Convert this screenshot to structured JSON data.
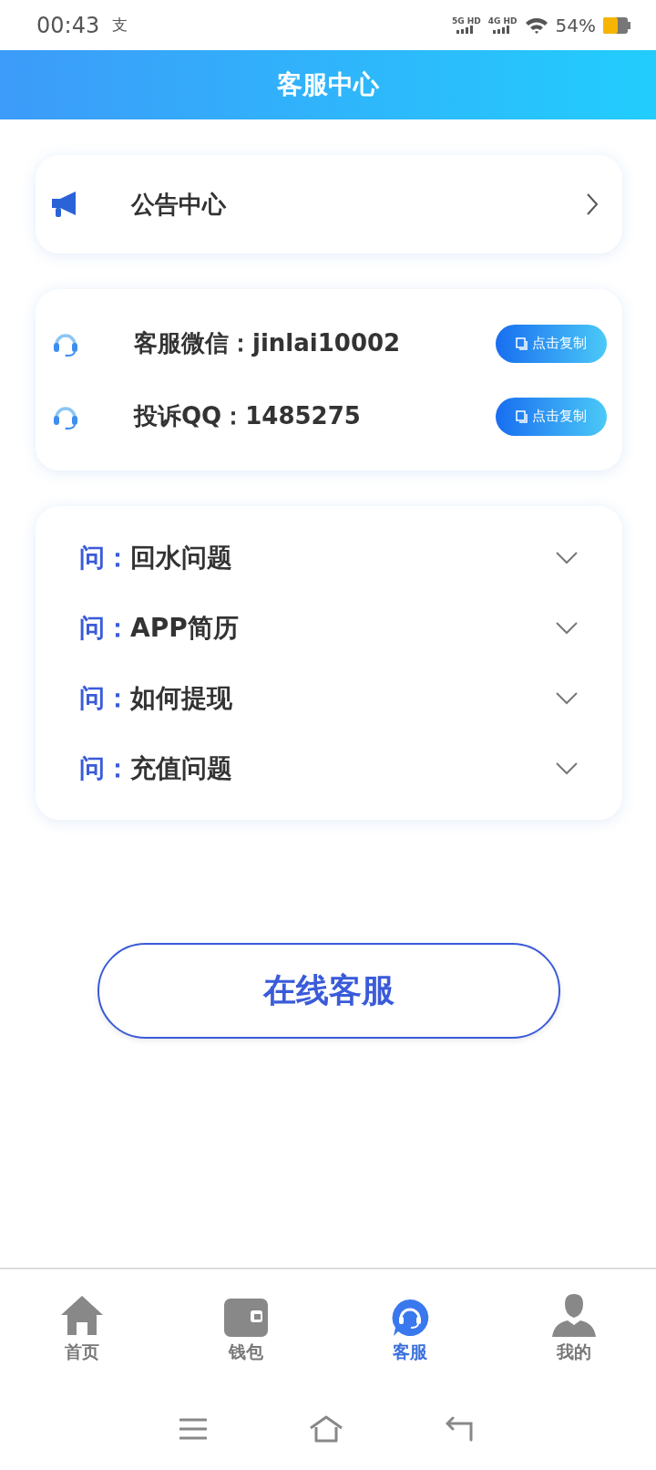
{
  "status_bar": {
    "time": "00:43",
    "notification": "支",
    "signal_1": "5G HD",
    "signal_2": "4G HD",
    "battery": "54%"
  },
  "header": {
    "title": "客服中心"
  },
  "notice": {
    "label": "公告中心"
  },
  "contacts": [
    {
      "label": "客服微信：jinlai10002",
      "button": "点击复制"
    },
    {
      "label": "投诉QQ：1485275",
      "button": "点击复制"
    }
  ],
  "faq": [
    {
      "prefix": "问：",
      "question": "回水问题",
      "expanded": false
    },
    {
      "prefix": "问：",
      "question": "APP简历",
      "expanded": false
    },
    {
      "prefix": "问：",
      "question": "如何提现",
      "expanded": false
    },
    {
      "prefix": "问：",
      "question": "充值问题",
      "expanded": false
    }
  ],
  "online_button": "在线客服",
  "tabs": [
    {
      "label": "首页",
      "kind": "home",
      "selected": false
    },
    {
      "label": "钱包",
      "kind": "wallet",
      "selected": false
    },
    {
      "label": "客服",
      "kind": "service",
      "selected": true
    },
    {
      "label": "我的",
      "kind": "profile",
      "selected": false
    }
  ]
}
